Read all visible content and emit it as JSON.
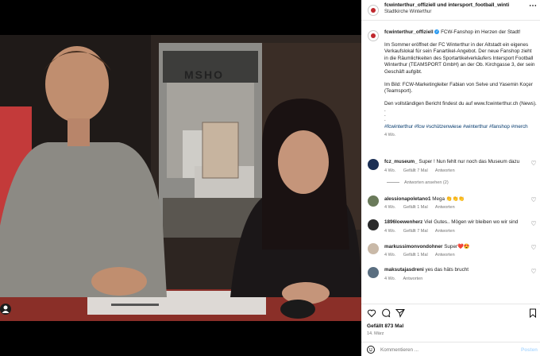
{
  "post": {
    "header": {
      "accounts": "fcwinterthur_offiziell und intersport_football_winti",
      "location": "Stadtkirche Winterthur",
      "more_icon": "more-dots-icon"
    },
    "caption": {
      "username": "fcwinterthur_offiziell",
      "title": "FCW-Fanshop im Herzen der Stadt!",
      "paragraph1": "Im Sommer eröffnet der FC Winterthur in der Altstadt ein eigenes Verkaufslokal für sein Fanartikel-Angebot. Der neue Fanshop zieht in die Räumlichkeiten des Sportartikelverkäufers Intersport Football Winterthur (TEAMSPORT GmbH) an der Ob. Kirchgasse 3, der sein Geschäft aufgibt.",
      "paragraph2": "Im Bild: FCW-Marketingleiter Fabian von Selve und Yasemin Koçer (Teamsport).",
      "paragraph3": "Den vollständigen Bericht findest du auf www.fcwinterthur.ch (News).",
      "dots": ".\n.\n.",
      "hashtags": "#fcwinterthur #fcw #schützenwiese #winterthur #fanshop #merch",
      "age": "4 Wo."
    },
    "comments": [
      {
        "user": "fcz_museum_",
        "text": "Super ! Nun fehlt nur noch das Museum dazu",
        "age": "4 Wo.",
        "likes": "Gefällt 7 Mal",
        "reply": "Antworten",
        "view_replies": "Antworten ansehen (2)"
      },
      {
        "user": "alessionapoletano1",
        "text": "Mega 👏👏👏",
        "age": "4 Wo.",
        "likes": "Gefällt 1 Mal",
        "reply": "Antworten"
      },
      {
        "user": "1896loewenherz",
        "text": "Viel Gutes.. Mögen wir bleiben wo wir sind",
        "age": "4 Wo.",
        "likes": "Gefällt 7 Mal",
        "reply": "Antworten"
      },
      {
        "user": "markussimonvondohner",
        "text": "Super❤️😍",
        "age": "4 Wo.",
        "likes": "Gefällt 1 Mal",
        "reply": "Antworten"
      },
      {
        "user": "maksutajasdreni",
        "text": "yes das häts brucht",
        "age": "4 Wo.",
        "likes": "",
        "reply": "Antworten"
      }
    ],
    "likes": "Gefällt 873 Mal",
    "date": "14. März",
    "comment_input": {
      "placeholder": "Kommentieren ...",
      "button": "Posten"
    },
    "photo": {
      "storefront_text": "MSHO"
    }
  }
}
